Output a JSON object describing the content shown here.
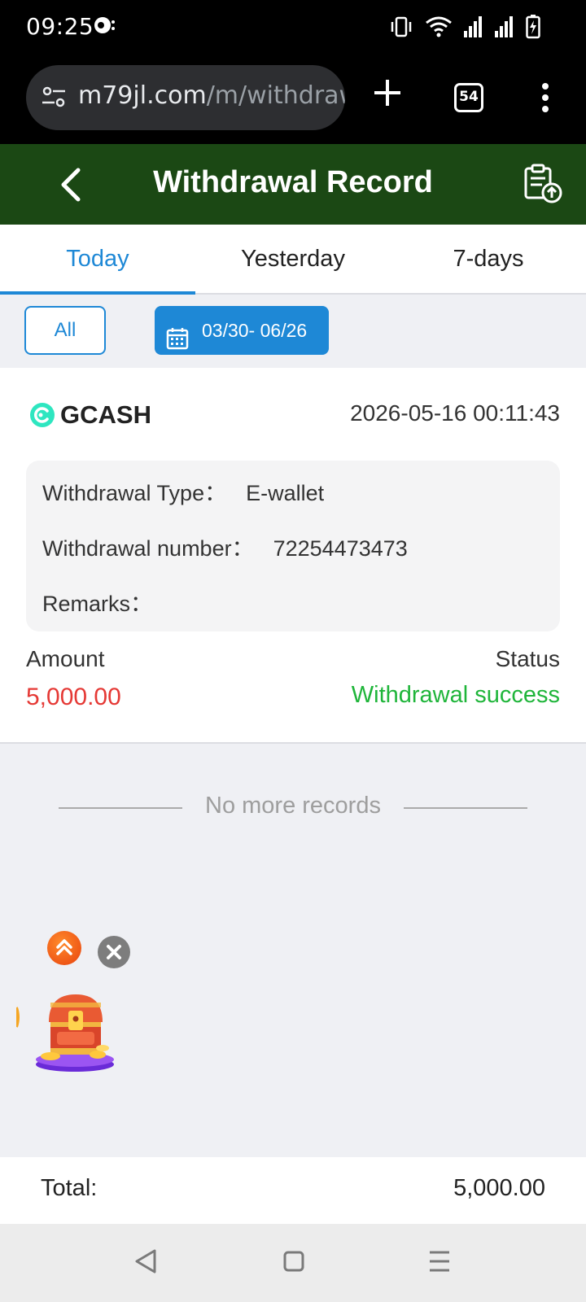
{
  "status_bar": {
    "time": "09:25",
    "icons": [
      "chat-notification-icon",
      "vibrate-icon",
      "wifi-icon",
      "signal-icon",
      "signal-icon",
      "battery-charging-icon"
    ]
  },
  "browser": {
    "url_host": "m79jl.com",
    "url_path": "/m/withdraw",
    "tab_count": "54",
    "icons": [
      "site-settings-icon",
      "new-tab-plus-icon",
      "tab-switcher-icon",
      "menu-kebab-icon"
    ]
  },
  "header": {
    "title": "Withdrawal Record",
    "icons": [
      "back-chevron-icon",
      "clipboard-upload-icon"
    ]
  },
  "tabs": [
    {
      "label": "Today",
      "active": true
    },
    {
      "label": "Yesterday",
      "active": false
    },
    {
      "label": "7-days",
      "active": false
    }
  ],
  "filters": {
    "all_label": "All",
    "date_range": "03/30- 06/26"
  },
  "record": {
    "method": "GCASH",
    "datetime": "2026-05-16 00:11:43",
    "type_label": "Withdrawal Type：",
    "type_value": "E-wallet",
    "number_label": "Withdrawal number：",
    "number_value": "72254473473",
    "remarks_label": "Remarks：",
    "remarks_value": "",
    "amount_label": "Amount",
    "amount_value": "5,000.00",
    "status_label": "Status",
    "status_value": "Withdrawal success"
  },
  "list_footer": "No more records",
  "total": {
    "label": "Total:",
    "value": "5,000.00"
  },
  "colors": {
    "header_bg": "#1b4814",
    "accent": "#1e88d6",
    "amount": "#e53935",
    "success": "#1fb53a"
  }
}
